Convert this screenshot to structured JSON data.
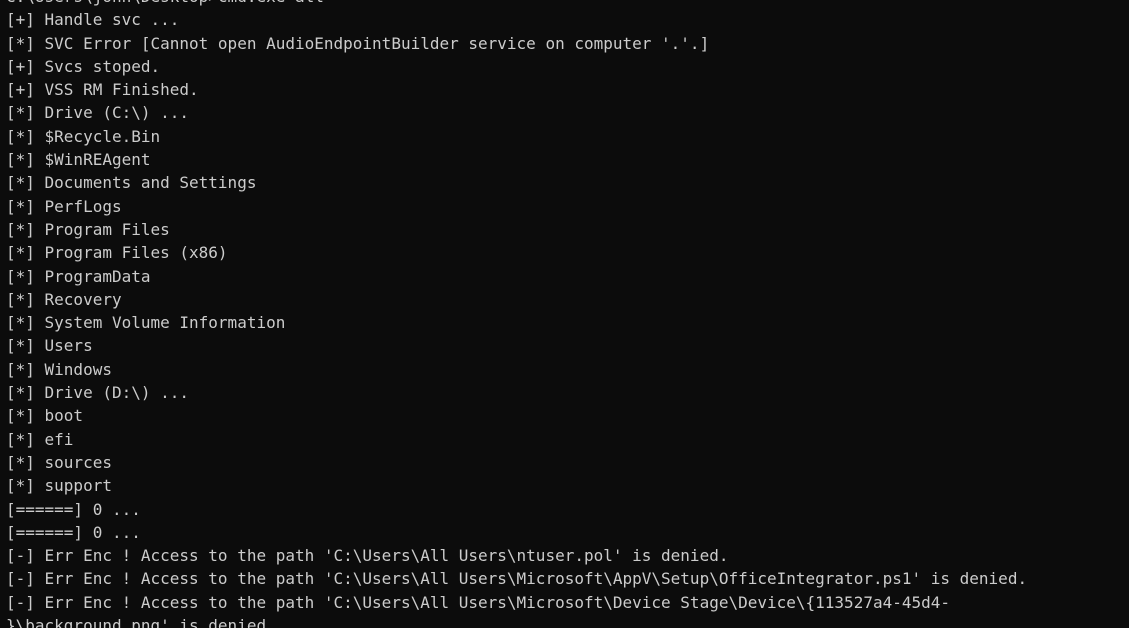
{
  "console": {
    "lines": [
      "C:\\Users\\john\\Desktop>cmd.exe all",
      "[+] Handle svc ...",
      "[*] SVC Error [Cannot open AudioEndpointBuilder service on computer '.'.]",
      "[+] Svcs stoped.",
      "[+] VSS RM Finished.",
      "[*] Drive (C:\\) ...",
      "[*] $Recycle.Bin",
      "[*] $WinREAgent",
      "[*] Documents and Settings",
      "[*] PerfLogs",
      "[*] Program Files",
      "[*] Program Files (x86)",
      "[*] ProgramData",
      "[*] Recovery",
      "[*] System Volume Information",
      "[*] Users",
      "[*] Windows",
      "[*] Drive (D:\\) ...",
      "[*] boot",
      "[*] efi",
      "[*] sources",
      "[*] support",
      "[======] 0 ...",
      "[======] 0 ...",
      "[-] Err Enc ! Access to the path 'C:\\Users\\All Users\\ntuser.pol' is denied.",
      "[-] Err Enc ! Access to the path 'C:\\Users\\All Users\\Microsoft\\AppV\\Setup\\OfficeIntegrator.ps1' is denied.",
      "[-] Err Enc ! Access to the path 'C:\\Users\\All Users\\Microsoft\\Device Stage\\Device\\{113527a4-45d4-",
      "}\\background.png' is denied."
    ],
    "cursor": "_"
  }
}
